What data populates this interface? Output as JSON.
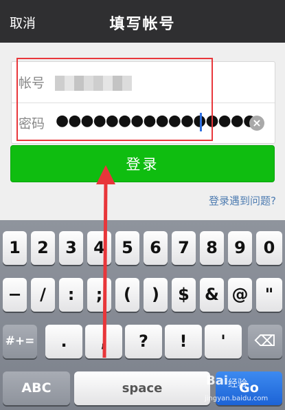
{
  "navbar": {
    "cancel_label": "取消",
    "title": "填写帐号"
  },
  "form": {
    "account_label": "帐号",
    "password_label": "密码",
    "password_masked": "●●●●●●●●●●●●●●●●",
    "clear_icon": "clear-circle-icon"
  },
  "login_label": "登录",
  "help_link": "登录遇到问题?",
  "keyboard": {
    "row1": [
      "1",
      "2",
      "3",
      "4",
      "5",
      "6",
      "7",
      "8",
      "9",
      "0"
    ],
    "row2": [
      "−",
      "/",
      ":",
      ";",
      "(",
      ")",
      "$",
      "&",
      "@",
      "\""
    ],
    "row3": [
      "#+=",
      ".",
      ",",
      "?",
      "!",
      "'",
      "⌫"
    ],
    "row4": {
      "abc": "ABC",
      "space": "space",
      "go": "Go"
    }
  },
  "watermark": {
    "logo": "Bai",
    "text": "经验",
    "url": "jingyan.baidu.com"
  },
  "colors": {
    "accent": "#0fbd10",
    "highlight": "#e8363a",
    "navbar": "#2f2f31",
    "link": "#4e7cb1"
  }
}
